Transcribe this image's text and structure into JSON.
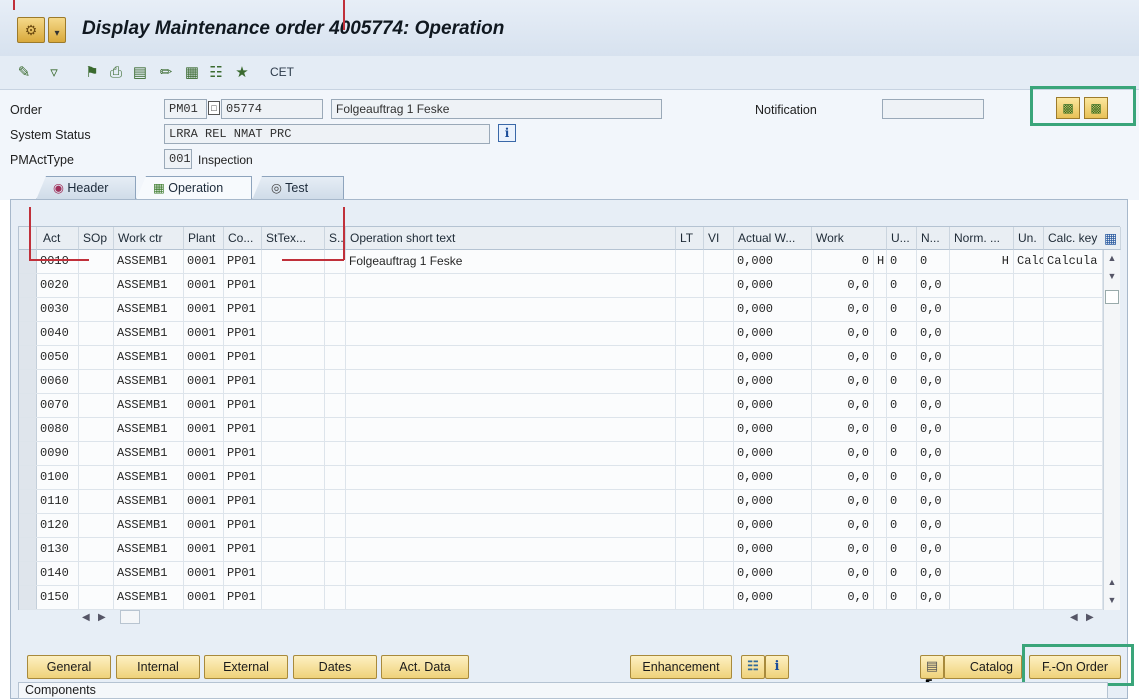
{
  "window": {
    "title": "Display Maintenance order 4005774: Operation",
    "toolbar_text": "CET"
  },
  "header": {
    "order_label": "Order",
    "order_type": "PM01",
    "order_number": "05774",
    "order_description": "Folgeauftrag 1 Feske",
    "notification_label": "Notification",
    "notification_value": "",
    "system_status_label": "System Status",
    "system_status_value": "LRRA REL  NMAT PRC",
    "info_glyph": "i",
    "pmacttype_label": "PMActType",
    "pmacttype_code": "001",
    "pmacttype_text": "Inspection"
  },
  "tabs": [
    "Header",
    "Operation",
    "Test"
  ],
  "active_tab": "Operation",
  "table": {
    "columns": [
      "Act",
      "SOp",
      "Work ctr",
      "Plant",
      "Co...",
      "StTex...",
      "S...",
      "Operation short text",
      "LT",
      "VI",
      "Actual W...",
      "Work",
      "U...",
      "N...",
      "Norm. ...",
      "Un.",
      "Calc. key"
    ],
    "rows": [
      [
        "0010",
        "",
        "ASSEMB1",
        "0001",
        "PP01",
        "",
        "",
        "Folgeauftrag 1 Feske",
        "",
        "",
        "0,000",
        "0",
        "H",
        "0",
        "0",
        "H",
        "Calcula"
      ],
      [
        "0020",
        "",
        "ASSEMB1",
        "0001",
        "PP01",
        "",
        "",
        "",
        "",
        "",
        "0,000",
        "0,0",
        "",
        "0",
        "0,0",
        "",
        ""
      ],
      [
        "0030",
        "",
        "ASSEMB1",
        "0001",
        "PP01",
        "",
        "",
        "",
        "",
        "",
        "0,000",
        "0,0",
        "",
        "0",
        "0,0",
        "",
        ""
      ],
      [
        "0040",
        "",
        "ASSEMB1",
        "0001",
        "PP01",
        "",
        "",
        "",
        "",
        "",
        "0,000",
        "0,0",
        "",
        "0",
        "0,0",
        "",
        ""
      ],
      [
        "0050",
        "",
        "ASSEMB1",
        "0001",
        "PP01",
        "",
        "",
        "",
        "",
        "",
        "0,000",
        "0,0",
        "",
        "0",
        "0,0",
        "",
        ""
      ],
      [
        "0060",
        "",
        "ASSEMB1",
        "0001",
        "PP01",
        "",
        "",
        "",
        "",
        "",
        "0,000",
        "0,0",
        "",
        "0",
        "0,0",
        "",
        ""
      ],
      [
        "0070",
        "",
        "ASSEMB1",
        "0001",
        "PP01",
        "",
        "",
        "",
        "",
        "",
        "0,000",
        "0,0",
        "",
        "0",
        "0,0",
        "",
        ""
      ],
      [
        "0080",
        "",
        "ASSEMB1",
        "0001",
        "PP01",
        "",
        "",
        "",
        "",
        "",
        "0,000",
        "0,0",
        "",
        "0",
        "0,0",
        "",
        ""
      ],
      [
        "0090",
        "",
        "ASSEMB1",
        "0001",
        "PP01",
        "",
        "",
        "",
        "",
        "",
        "0,000",
        "0,0",
        "",
        "0",
        "0,0",
        "",
        ""
      ],
      [
        "0100",
        "",
        "ASSEMB1",
        "0001",
        "PP01",
        "",
        "",
        "",
        "",
        "",
        "0,000",
        "0,0",
        "",
        "0",
        "0,0",
        "",
        ""
      ],
      [
        "0110",
        "",
        "ASSEMB1",
        "0001",
        "PP01",
        "",
        "",
        "",
        "",
        "",
        "0,000",
        "0,0",
        "",
        "0",
        "0,0",
        "",
        ""
      ],
      [
        "0120",
        "",
        "ASSEMB1",
        "0001",
        "PP01",
        "",
        "",
        "",
        "",
        "",
        "0,000",
        "0,0",
        "",
        "0",
        "0,0",
        "",
        ""
      ],
      [
        "0130",
        "",
        "ASSEMB1",
        "0001",
        "PP01",
        "",
        "",
        "",
        "",
        "",
        "0,000",
        "0,0",
        "",
        "0",
        "0,0",
        "",
        ""
      ],
      [
        "0140",
        "",
        "ASSEMB1",
        "0001",
        "PP01",
        "",
        "",
        "",
        "",
        "",
        "0,000",
        "0,0",
        "",
        "0",
        "0,0",
        "",
        ""
      ],
      [
        "0150",
        "",
        "ASSEMB1",
        "0001",
        "PP01",
        "",
        "",
        "",
        "",
        "",
        "0,000",
        "0,0",
        "",
        "0",
        "0,0",
        "",
        ""
      ]
    ]
  },
  "buttons": {
    "general": "General",
    "internal": "Internal",
    "external": "External",
    "dates": "Dates",
    "act_data": "Act. Data",
    "enhancement": "Enhancement",
    "catalog": "Catalog",
    "f_on_order": "F.-On Order"
  },
  "components_label": "Components",
  "colors": {
    "highlight_box": "#3aa57a",
    "annotation_line": "#c0303a"
  }
}
